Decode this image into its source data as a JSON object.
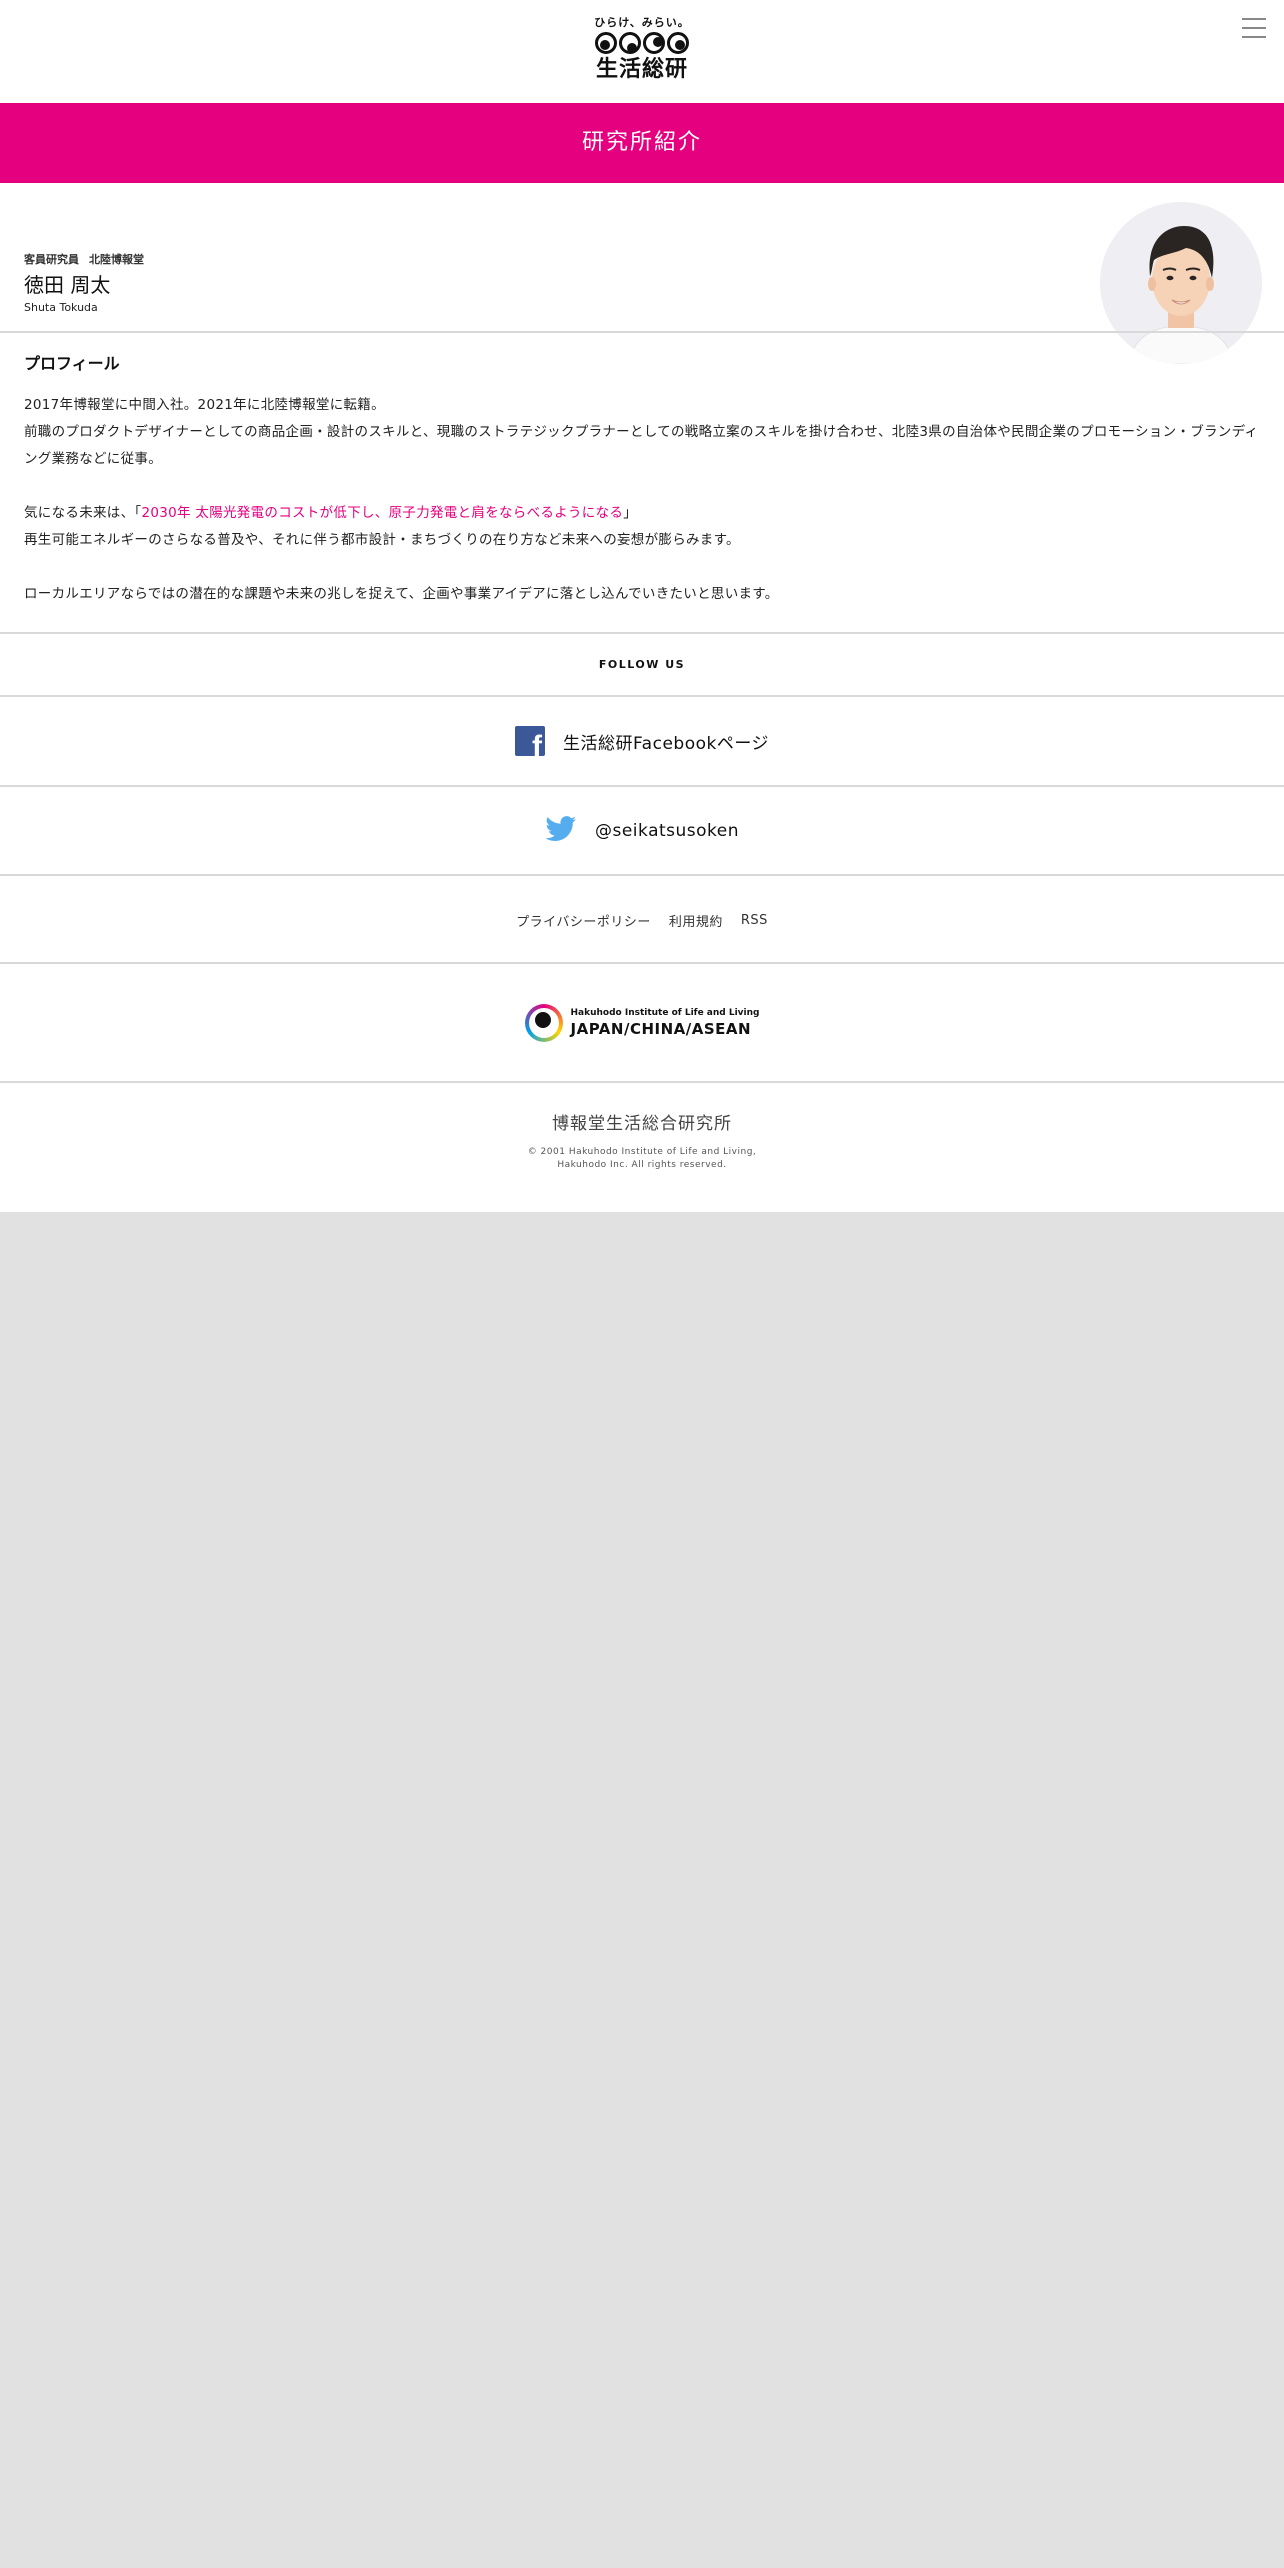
{
  "header": {
    "logo_tagline": "ひらけ、みらい。",
    "logo_name": "生活総研"
  },
  "banner": {
    "title": "研究所紹介"
  },
  "profile": {
    "position_title": "客員研究員",
    "department": "北陸博報堂",
    "name": "徳田 周太",
    "name_roman": "Shuta Tokuda",
    "section_title": "プロフィール",
    "paragraphs": {
      "p1_line1": "2017年博報堂に中間入社。2021年に北陸博報堂に転籍。",
      "p1_line2": "前職のプロダクトデザイナーとしての商品企画・設計のスキルと、現職のストラテジックプラナーとしての戦略立案のスキルを掛け合わせ、北陸3県の自治体や民間企業のプロモーション・ブランディング業務などに従事。",
      "p2_prefix": "気になる未来は、「",
      "p2_highlight": "2030年 太陽光発電のコストが低下し、原子力発電と肩をならべるようになる",
      "p2_suffix": "」",
      "p2_line2": "再生可能エネルギーのさらなる普及や、それに伴う都市設計・まちづくりの在り方など未来への妄想が膨らみます。",
      "p3": "ローカルエリアならではの潜在的な課題や未来の兆しを捉えて、企画や事業アイデアに落とし込んでいきたいと思います。"
    }
  },
  "footer": {
    "follow_label": "FOLLOW US",
    "facebook_label": "生活総研Facebookページ",
    "twitter_label": "@seikatsusoken",
    "links": {
      "privacy": "プライバシーポリシー",
      "terms": "利用規約",
      "rss": "RSS"
    },
    "brand_sub": "Hakuhodo Institute of Life and Living",
    "brand_main": "JAPAN/CHINA/ASEAN",
    "org_name": "博報堂生活総合研究所",
    "copyright_line1": "© 2001 Hakuhodo Institute of Life and Living,",
    "copyright_line2": "Hakuhodo Inc. All rights reserved."
  },
  "colors": {
    "accent": "#e5007f",
    "facebook": "#3b5998",
    "twitter": "#55acee",
    "background": "#e1e1e1"
  }
}
